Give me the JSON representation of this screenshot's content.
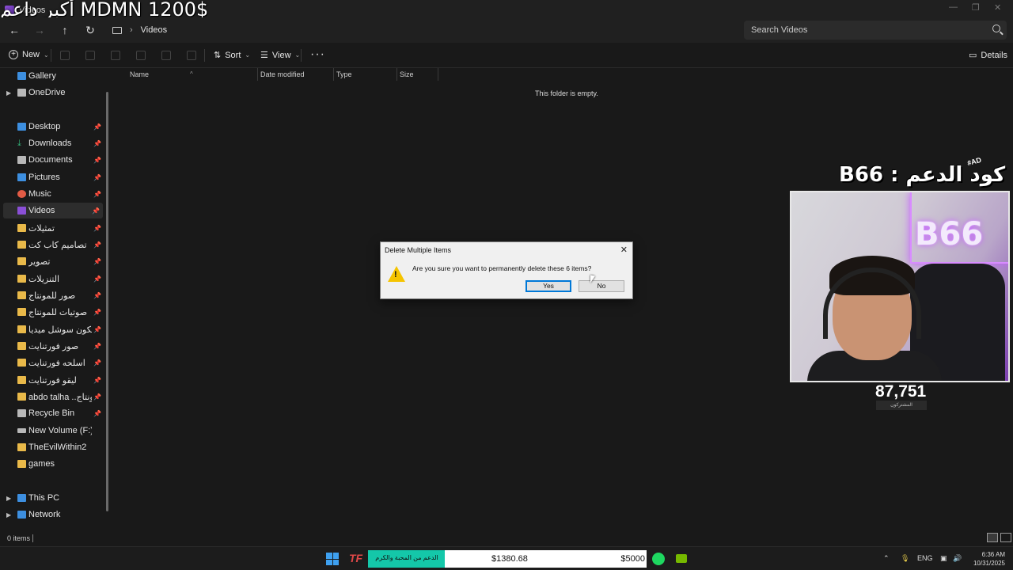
{
  "window": {
    "tab_title": "Videos",
    "overlay_title": "أكبر داعم MDMN 1200$"
  },
  "nav": {
    "breadcrumb": "Videos",
    "search_placeholder": "Search Videos"
  },
  "commands": {
    "new": "New",
    "sort": "Sort",
    "view": "View",
    "details": "Details"
  },
  "sidebar": {
    "items": [
      {
        "label": "Gallery"
      },
      {
        "label": "OneDrive"
      },
      {
        "label": "Desktop"
      },
      {
        "label": "Downloads"
      },
      {
        "label": "Documents"
      },
      {
        "label": "Pictures"
      },
      {
        "label": "Music"
      },
      {
        "label": "Videos"
      },
      {
        "label": "تمثيلات"
      },
      {
        "label": "تصاميم كاب كت"
      },
      {
        "label": "تصوير"
      },
      {
        "label": "التنزيلات"
      },
      {
        "label": "صور للمونتاج"
      },
      {
        "label": "صوتيات للمونتاج"
      },
      {
        "label": "ايكون سوشل ميديا"
      },
      {
        "label": "صور فورتنايت"
      },
      {
        "label": "اسلحه فورتنايت"
      },
      {
        "label": "ليقو فورتنايت"
      },
      {
        "label": "abdo talha ..تات المونتاج"
      },
      {
        "label": "Recycle Bin"
      },
      {
        "label": "New Volume (F:)"
      },
      {
        "label": "TheEvilWithin2"
      },
      {
        "label": "games"
      },
      {
        "label": "This PC"
      },
      {
        "label": "Network"
      }
    ]
  },
  "columns": {
    "name": "Name",
    "date": "Date modified",
    "type": "Type",
    "size": "Size"
  },
  "content": {
    "empty_message": "This folder is empty."
  },
  "status": {
    "items": "0 items"
  },
  "dialog": {
    "title": "Delete Multiple Items",
    "message": "Are you sure you want to permanently delete these 6 items?",
    "yes": "Yes",
    "no": "No"
  },
  "stream": {
    "ad_tag": "#AD",
    "code_banner": "كود الدعم : B66",
    "neon_sign": "B66",
    "subscribers": "87,751",
    "subscribers_label": "المشتركون"
  },
  "taskbar": {
    "donate_label": "الدعم من المحبة والكرم",
    "donate_current": "$1380.68",
    "donate_goal": "$5000",
    "donate_progress": 0.276,
    "lang": "ENG",
    "time": "6:36 AM",
    "date": "10/31/2025"
  },
  "colors": {
    "accent": "#0078d7",
    "donate_fill": "#14c7a9",
    "folder": "#e9b949"
  }
}
